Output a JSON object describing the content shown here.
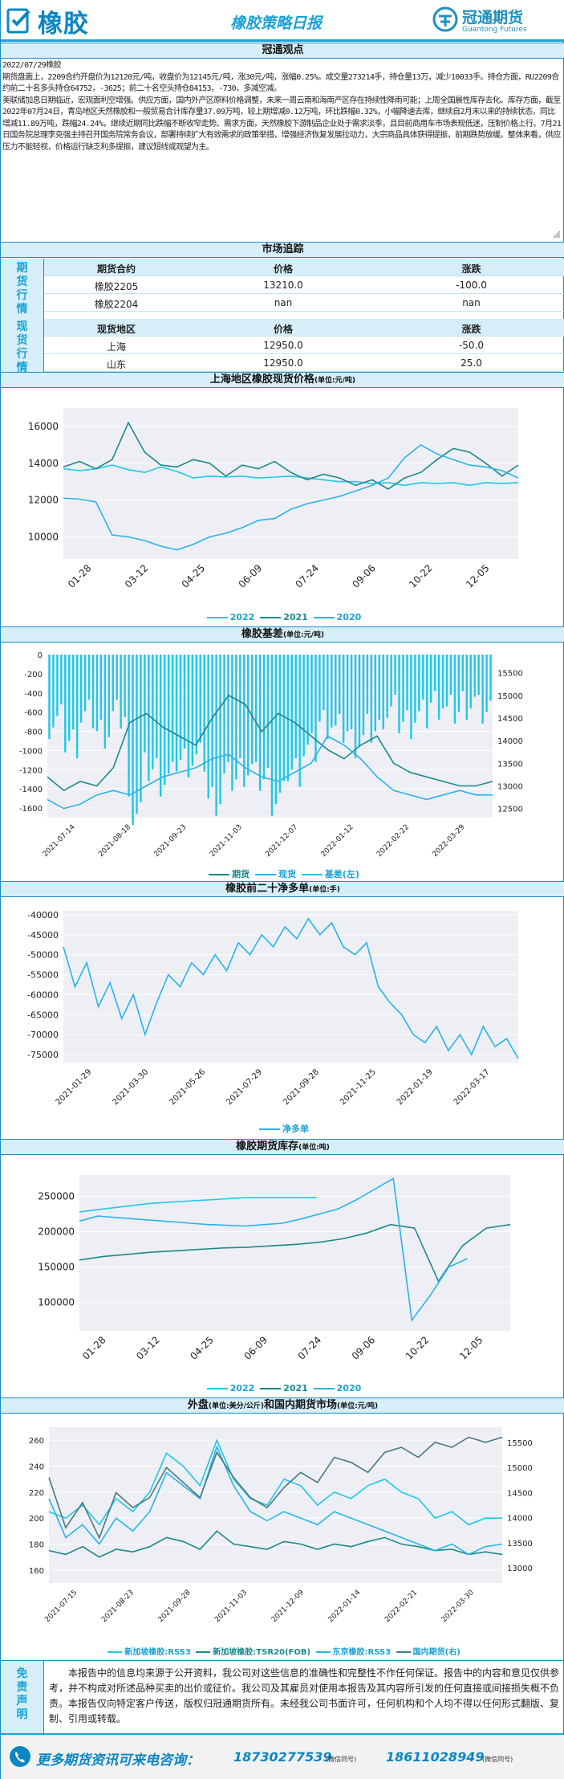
{
  "header": {
    "brand": "橡胶",
    "title": "橡胶策略日报",
    "company_cn": "冠通期货",
    "company_en": "Guantong Futures"
  },
  "view": {
    "section": "冠通观点",
    "date_line": "2022/07/29橡胶",
    "paragraphs": [
      "期货盘面上，2209合约开盘价为12120元/吨，收盘价为12145元/吨，涨30元/吨，涨幅0.25%。成交量273214手，持仓量13万，减少10033手。持仓方面，RU2209合约前二十名多头持仓64752，-3625；前二十名空头持仓84153，-730，多减空减。",
      "美联储加息日期临近，宏观面利空增强。供应方面，国内外产区原料价格调整，未来一周云南和海南产区存在持续性降雨可能；上周全国晨性库存去化。库存方面，截至2022年07月24日，青岛地区天然橡胶和一般贸易合计库存量37.09万吨，较上期增减0.12万吨，环比跌幅0.32%，小幅降速去库，继续自2月末以来的持续状态，同比增减11.89万吨，跌幅24.24%，继续近期同比跌幅不断收窄走势。需求方面，天然橡胶下游制品企业处于需求淡季，且目前商用车市场表现低迷，压制价格上行。7月21日国务院总理李克强主持召开国务院常务会议，部署持续扩大有效需求的政策举措，增强经济恢复发展拉动力，大宗商品具体获得提振，前期跌势放缓。整体来看，供应压力不能轻视，价格运行缺乏利多提振，建议短线或观望为主。"
    ]
  },
  "market": {
    "section": "市场追踪",
    "futures_label": "期货行情",
    "spot_label": "现货行情",
    "futures_head": [
      "期货合约",
      "价格",
      "涨跌"
    ],
    "futures_rows": [
      [
        "橡胶2205",
        "13210.0",
        "-100.0"
      ],
      [
        "橡胶2204",
        "nan",
        "nan"
      ]
    ],
    "spot_head": [
      "现货地区",
      "价格",
      "涨跌"
    ],
    "spot_rows": [
      [
        "上海",
        "12950.0",
        "-50.0"
      ],
      [
        "山东",
        "12950.0",
        "25.0"
      ]
    ]
  },
  "charts": {
    "c1": {
      "title": "上海地区橡胶现货价格",
      "unit": "(单位:元/吨)",
      "legend": [
        "2022",
        "2021",
        "2020"
      ]
    },
    "c2": {
      "title": "橡胶基差",
      "unit": "(单位:元/吨)",
      "legend": [
        "期货",
        "现货",
        "基差(左)"
      ]
    },
    "c3": {
      "title": "橡胶前二十净多单",
      "unit": "(单位:手)",
      "legend": [
        "净多单"
      ]
    },
    "c4": {
      "title": "橡胶期货库存",
      "unit": "(单位:吨)",
      "legend": [
        "2022",
        "2021",
        "2020"
      ]
    },
    "c5": {
      "title_a": "外盘",
      "unit_a": "(单位:美分/公斤)",
      "title_b": "和国内期货市场",
      "unit_b": "(单位:元/吨)",
      "legend": [
        "新加坡橡胶:RSS3",
        "新加坡橡胶:TSR20(FOB)",
        "东京橡胶:RSS3",
        "国内期货(右)"
      ]
    }
  },
  "colors": {
    "c2022": "#1ec8e6",
    "c2021": "#1a8a8a",
    "c2020": "#28b4ea",
    "grid": "#ececf4",
    "plotbg": "#eeeef5",
    "accent": "#1aa1d6"
  },
  "chart_data": [
    {
      "type": "line",
      "id": "spot-price",
      "xticks": [
        "01-28",
        "03-12",
        "04-25",
        "06-09",
        "07-24",
        "09-06",
        "10-22",
        "12-05"
      ],
      "yticks": [
        10000,
        12000,
        14000,
        16000
      ],
      "ylim": [
        8800,
        17000
      ],
      "series": [
        {
          "name": "2022",
          "values": [
            13700,
            13600,
            13700,
            13900,
            13650,
            13500,
            13800,
            13550,
            13200,
            13300,
            13250,
            13300,
            13200,
            13250,
            13300,
            13200,
            13100,
            13000,
            13000,
            12900,
            12950,
            12800,
            12950,
            12900,
            12950,
            12800,
            12950,
            12900,
            12950
          ]
        },
        {
          "name": "2021",
          "values": [
            13800,
            14100,
            13700,
            14200,
            16200,
            14600,
            13900,
            13800,
            14200,
            14000,
            13300,
            13900,
            13700,
            14100,
            13500,
            13100,
            13400,
            13200,
            12800,
            13100,
            12600,
            13200,
            13500,
            14200,
            14800,
            14600,
            14000,
            13300,
            13900
          ]
        },
        {
          "name": "2020",
          "values": [
            12100,
            12050,
            11900,
            10100,
            10000,
            9800,
            9500,
            9300,
            9600,
            10000,
            10200,
            10500,
            10900,
            11000,
            11500,
            11800,
            12000,
            12200,
            12500,
            12800,
            13200,
            14300,
            15000,
            14500,
            14200,
            13900,
            13800,
            13600,
            13200
          ]
        }
      ]
    },
    {
      "type": "line",
      "id": "basis",
      "xticks": [
        "2021-07-14",
        "2021-08-18",
        "2021-09-23",
        "2021-11-03",
        "2021-12-07",
        "2022-01-12",
        "2022-02-22",
        "2022-03-29"
      ],
      "yticks": [
        -1600,
        -1400,
        -1200,
        -1000,
        -800,
        -600,
        -400,
        -200,
        0
      ],
      "y2ticks": [
        12500,
        13000,
        13500,
        14000,
        14500,
        15000,
        15500
      ],
      "series": [
        {
          "name": "期货",
          "values": [
            13200,
            12900,
            13100,
            13000,
            13400,
            14400,
            14600,
            14300,
            14100,
            13900,
            14500,
            15000,
            14800,
            14200,
            14600,
            14400,
            14100,
            13800,
            13600,
            13900,
            14100,
            13500,
            13300,
            13200,
            13100,
            13000,
            13000,
            13100
          ]
        },
        {
          "name": "现货",
          "values": [
            12700,
            12500,
            12600,
            12800,
            12900,
            12800,
            13000,
            13200,
            13300,
            13400,
            13600,
            13700,
            13400,
            13200,
            13100,
            13300,
            13500,
            14100,
            13900,
            13600,
            13200,
            12900,
            12800,
            12700,
            12800,
            12900,
            12800,
            12800
          ]
        },
        {
          "name": "基差(左)",
          "values": [
            -700,
            -900,
            -650,
            -800,
            -650,
            -1600,
            -1200,
            -1300,
            -1100,
            -1100,
            -1500,
            -1300,
            -1200,
            -1300,
            -1500,
            -1200,
            -1000,
            -700,
            -800,
            -900,
            -800,
            -600,
            -700,
            -650,
            -500,
            -600,
            -500,
            -600
          ]
        }
      ]
    },
    {
      "type": "line",
      "id": "net-long",
      "xticks": [
        "2021-01-29",
        "2021-03-30",
        "2021-05-26",
        "2021-07-29",
        "2021-09-28",
        "2021-11-25",
        "2022-01-19",
        "2022-03-17"
      ],
      "yticks": [
        -75000,
        -70000,
        -65000,
        -60000,
        -55000,
        -50000,
        -45000,
        -40000
      ],
      "ylim": [
        -77000,
        -39000
      ],
      "series": [
        {
          "name": "净多单",
          "values": [
            -48000,
            -58000,
            -52000,
            -63000,
            -57000,
            -66000,
            -60000,
            -70000,
            -62000,
            -55000,
            -58000,
            -52000,
            -55000,
            -50000,
            -54000,
            -47000,
            -50000,
            -45000,
            -48000,
            -43000,
            -46000,
            -41000,
            -45000,
            -42000,
            -48000,
            -50000,
            -47000,
            -58000,
            -62000,
            -65000,
            -70000,
            -72000,
            -68000,
            -74000,
            -70000,
            -75000,
            -68000,
            -73000,
            -71000,
            -76000
          ]
        }
      ]
    },
    {
      "type": "line",
      "id": "inventory",
      "xticks": [
        "01-28",
        "03-12",
        "04-25",
        "06-09",
        "07-24",
        "09-06",
        "10-22",
        "12-05"
      ],
      "yticks": [
        100000,
        150000,
        200000,
        250000
      ],
      "ylim": [
        60000,
        280000
      ],
      "series": [
        {
          "name": "2022",
          "values": [
            228000,
            232000,
            236000,
            240000,
            242000,
            244000,
            246000,
            248000,
            248000,
            248000,
            248000
          ]
        },
        {
          "name": "2021",
          "values": [
            160000,
            165000,
            168000,
            171000,
            173000,
            175000,
            177000,
            178000,
            180000,
            182000,
            185000,
            190000,
            198000,
            210000,
            205000,
            130000,
            180000,
            205000,
            210000
          ]
        },
        {
          "name": "2020",
          "values": [
            215000,
            222000,
            220000,
            218000,
            216000,
            214000,
            212000,
            210000,
            209000,
            208000,
            210000,
            212000,
            218000,
            225000,
            232000,
            245000,
            260000,
            275000,
            75000,
            110000,
            150000,
            162000
          ]
        }
      ]
    },
    {
      "type": "line",
      "id": "ext-dom",
      "xticks": [
        "2021-07-15",
        "2021-08-23",
        "2021-09-28",
        "2021-11-03",
        "2021-12-09",
        "2022-01-14",
        "2022-02-21",
        "2022-03-30"
      ],
      "yticks": [
        160,
        180,
        200,
        220,
        240,
        260
      ],
      "y2ticks": [
        13000,
        13500,
        14000,
        14500,
        15000,
        15500
      ],
      "series": [
        {
          "name": "新加坡橡胶:RSS3",
          "values": [
            205,
            200,
            210,
            195,
            215,
            205,
            220,
            250,
            240,
            225,
            260,
            230,
            215,
            210,
            230,
            225,
            210,
            220,
            215,
            225,
            230,
            220,
            215,
            200,
            205,
            195,
            200,
            200
          ]
        },
        {
          "name": "新加坡橡胶:TSR20(FOB)",
          "values": [
            175,
            172,
            178,
            170,
            176,
            174,
            178,
            185,
            182,
            176,
            190,
            180,
            178,
            176,
            182,
            180,
            176,
            180,
            178,
            182,
            185,
            180,
            178,
            175,
            176,
            172,
            174,
            172
          ]
        },
        {
          "name": "东京橡胶:RSS3",
          "values": [
            215,
            185,
            195,
            180,
            200,
            190,
            205,
            235,
            225,
            215,
            255,
            225,
            205,
            198,
            205,
            200,
            195,
            205,
            200,
            195,
            190,
            185,
            180,
            175,
            180,
            172,
            178,
            180
          ]
        },
        {
          "name": "国内期货(右)",
          "values": [
            14800,
            13800,
            14300,
            13600,
            14500,
            14200,
            14400,
            15000,
            14700,
            14400,
            15300,
            14800,
            14400,
            14200,
            14600,
            14900,
            14700,
            15200,
            15100,
            14900,
            15300,
            15400,
            15200,
            15500,
            15400,
            15600,
            15500,
            15600
          ]
        }
      ]
    }
  ],
  "disclaimer": {
    "label": "免责声明",
    "text": "本报告中的信息均来源于公开资料，我公司对这些信息的准确性和完整性不作任何保证。报告中的内容和意见仅供参考，并不构成对所述品种买卖的出价或征价。我公司及其雇员对使用本报告及其内容所引发的任何直接或间接损失概不负责。本报告仅向特定客户传送，版权归冠通期货所有。未经我公司书面许可，任何机构和个人均不得以任何形式翻版、复制、引用或转载。"
  },
  "footer": {
    "msg": "更多期货资讯可来电咨询：",
    "phone1": "18730277539",
    "wx1": "(微信同号)",
    "phone2": "18611028949",
    "wx2": "(微信同号)"
  }
}
